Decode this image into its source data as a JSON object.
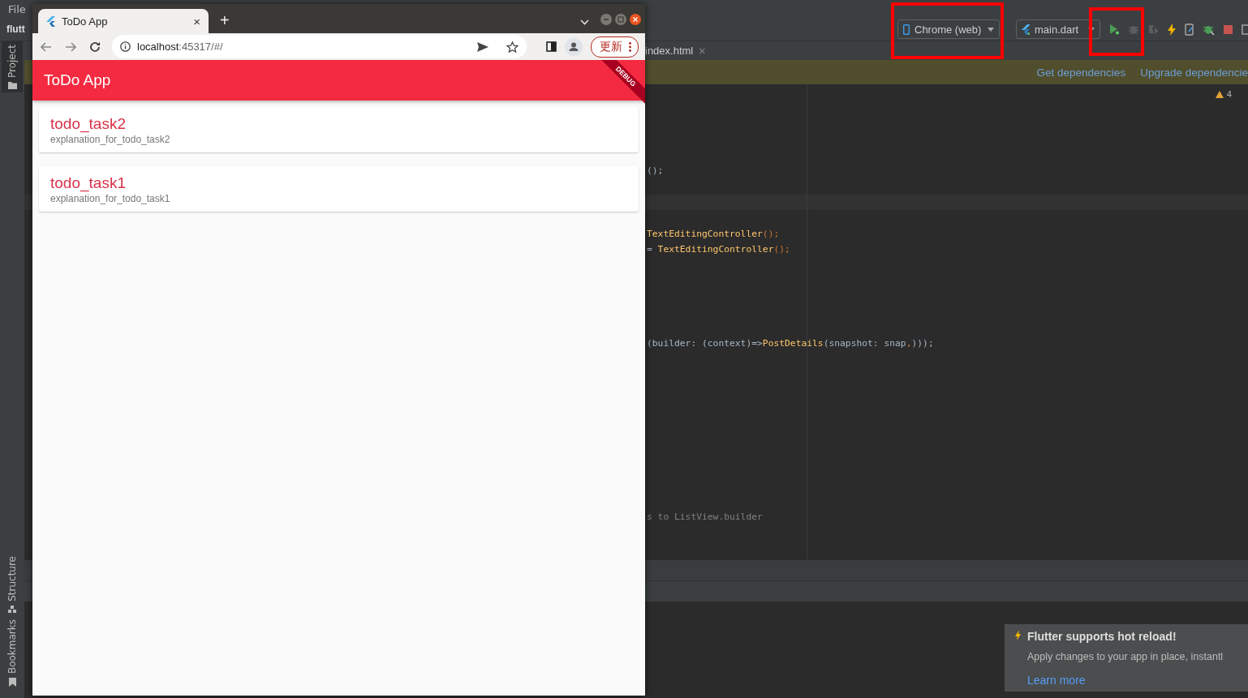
{
  "ide": {
    "menu": "File",
    "project_name": "flutt",
    "tool_windows": [
      {
        "label": "Project",
        "kind": "folder",
        "selected": true
      },
      {
        "label": "Structure",
        "kind": "structure",
        "selected": false
      },
      {
        "label": "Bookmarks",
        "kind": "bookmark",
        "selected": false
      }
    ],
    "toolbar": {
      "device": "Chrome (web)",
      "run_config": "main.dart"
    },
    "editor_tab": {
      "label": "index.html",
      "close": "×"
    },
    "banner_links": [
      "Get dependencies",
      "Upgrade dependencie"
    ],
    "warnings": "4",
    "code_lines": [
      {
        "segments": [
          {
            "text": "();",
            "kind": "plain"
          }
        ]
      },
      {
        "segments": [
          {
            "text": "TextEditingController",
            "kind": "call"
          },
          {
            "text": "();",
            "kind": "keyword"
          }
        ]
      },
      {
        "segments": [
          {
            "text": "= ",
            "kind": "plain"
          },
          {
            "text": "TextEditingController",
            "kind": "call"
          },
          {
            "text": "();",
            "kind": "keyword"
          }
        ]
      },
      {
        "segments": [
          {
            "text": "(builder: (context)=>",
            "kind": "plain"
          },
          {
            "text": "PostDetails",
            "kind": "call"
          },
          {
            "text": "(snapshot: snap",
            "kind": "plain"
          },
          {
            "text": ",",
            "kind": "keyword"
          },
          {
            "text": ")));",
            "kind": "plain"
          }
        ]
      },
      {
        "segments": [
          {
            "text": "s to ListView.builder",
            "kind": "comment"
          }
        ]
      }
    ],
    "notification": {
      "title": "Flutter supports hot reload!",
      "body": "Apply changes to your app in place, instantl",
      "link": "Learn more"
    }
  },
  "browser": {
    "tab": {
      "title": "ToDo App",
      "close": "×"
    },
    "new_tab": "+",
    "address": "localhost:45317/#/",
    "update_button": "更新",
    "app": {
      "title": "ToDo App",
      "banner": "DEBUG",
      "todos": [
        {
          "title": "todo_task2",
          "description": "explanation_for_todo_task2"
        },
        {
          "title": "todo_task1",
          "description": "explanation_for_todo_task1"
        }
      ]
    }
  }
}
